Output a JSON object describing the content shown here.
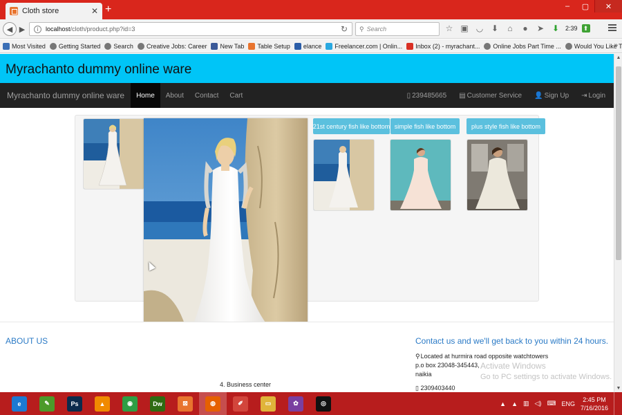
{
  "browser": {
    "tab_title": "Cloth store",
    "tab_close": "✕",
    "new_tab": "+",
    "url_host": "localhost",
    "url_path": "/cloth/product.php?id=3",
    "search_placeholder": "Search",
    "download_time": "2:39",
    "window_controls": [
      "–",
      "▢",
      "✕"
    ]
  },
  "bookmarks": [
    {
      "label": "Most Visited",
      "icon": "star-icon",
      "color": "#3b6fb6"
    },
    {
      "label": "Getting Started",
      "icon": "globe-icon",
      "color": "#777777"
    },
    {
      "label": "Search",
      "icon": "globe-icon",
      "color": "#777777"
    },
    {
      "label": "Creative Jobs: Career",
      "icon": "globe-icon",
      "color": "#777777"
    },
    {
      "label": "New Tab",
      "icon": "facebook-icon",
      "color": "#3b5998"
    },
    {
      "label": "Table Setup",
      "icon": "xampp-icon",
      "color": "#e8742e"
    },
    {
      "label": "elance",
      "icon": "elance-icon",
      "color": "#2b5da8"
    },
    {
      "label": "Freelancer.com | Onlin...",
      "icon": "freelancer-icon",
      "color": "#29a8e0"
    },
    {
      "label": "Inbox (2) - myrachant...",
      "icon": "gmail-icon",
      "color": "#d93025"
    },
    {
      "label": "Online Jobs Part Time ...",
      "icon": "globe-icon",
      "color": "#777777"
    },
    {
      "label": "Would You Like To Ear...",
      "icon": "globe-icon",
      "color": "#777777"
    }
  ],
  "bookmarks_more": "»",
  "site": {
    "header_title": "Myrachanto dummy online ware",
    "brand": "Myrachanto dummy online ware",
    "nav_links": [
      "Home",
      "About",
      "Contact",
      "Cart"
    ],
    "nav_active": "Home",
    "nav_right": [
      {
        "label": "239485665",
        "icon": "phone-icon",
        "glyph": "▯"
      },
      {
        "label": "Customer Service",
        "icon": "document-icon",
        "glyph": "▤"
      },
      {
        "label": "Sign Up",
        "icon": "user-icon",
        "glyph": "👤"
      },
      {
        "label": "Login",
        "icon": "login-icon",
        "glyph": "⇥"
      }
    ]
  },
  "related": [
    {
      "label": "21st century fish like bottom",
      "style": "slim"
    },
    {
      "label": "simple fish like bottom",
      "style": "teal"
    },
    {
      "label": "plus style fish like bottom",
      "style": "grey"
    }
  ],
  "footer": {
    "about_heading": "ABOUT US",
    "contact_heading": "Contact us and we'll get back to you within 24 hours.",
    "address_line1": "Located at hurmira road opposite watchtowers",
    "address_line2": "p.o box 23048-345443,",
    "address_line3": "naikia",
    "phone": "2309403440",
    "business_center": "4. Business center"
  },
  "watermark": {
    "line1": "Activate Windows",
    "line2": "Go to PC settings to activate Windows."
  },
  "taskbar": {
    "apps": [
      {
        "name": "ie-icon",
        "glyph": "e",
        "color": "#1d79d2"
      },
      {
        "name": "notepad-icon",
        "glyph": "✎",
        "color": "#4c9a2a"
      },
      {
        "name": "photoshop-icon",
        "glyph": "Ps",
        "color": "#0b2b4c"
      },
      {
        "name": "vlc-icon",
        "glyph": "▲",
        "color": "#f08a00"
      },
      {
        "name": "chrome-icon",
        "glyph": "◉",
        "color": "#2e9e44"
      },
      {
        "name": "dreamweaver-icon",
        "glyph": "Dw",
        "color": "#2e6b12"
      },
      {
        "name": "xampp-icon",
        "glyph": "⊠",
        "color": "#e8742e"
      },
      {
        "name": "firefox-icon",
        "glyph": "◍",
        "color": "#e66000"
      },
      {
        "name": "paint-icon",
        "glyph": "✐",
        "color": "#d2453c"
      },
      {
        "name": "explorer-icon",
        "glyph": "▭",
        "color": "#e0b43a"
      },
      {
        "name": "picasa-icon",
        "glyph": "✿",
        "color": "#7a3fa0"
      },
      {
        "name": "camera-icon",
        "glyph": "◎",
        "color": "#111111"
      }
    ],
    "active_app": "firefox-icon",
    "tray_lang": "ENG",
    "time": "2:45 PM",
    "date": "7/16/2016"
  },
  "colors": {
    "jumbotron": "#00c5f7",
    "navbar": "#222222",
    "button_info": "#5bc0de",
    "titlebar": "#d9261c",
    "taskbar": "#b71d1d"
  }
}
